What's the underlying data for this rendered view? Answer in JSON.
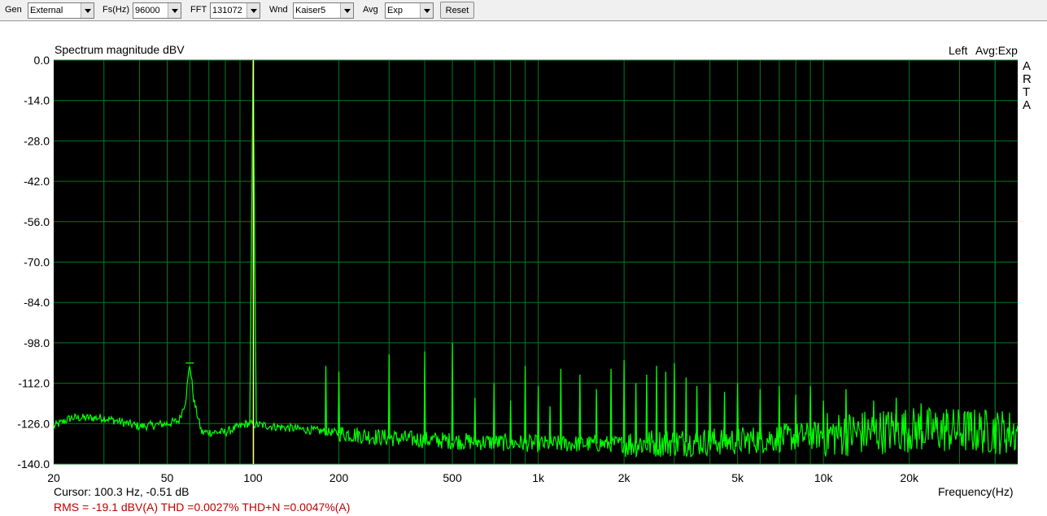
{
  "toolbar": {
    "gen_label": "Gen",
    "gen_value": "External",
    "fs_label": "Fs(Hz)",
    "fs_value": "96000",
    "fft_label": "FFT",
    "fft_value": "131072",
    "wnd_label": "Wnd",
    "wnd_value": "Kaiser5",
    "avg_label": "Avg",
    "avg_value": "Exp",
    "reset_label": "Reset"
  },
  "header": {
    "channel": "Left",
    "avg": "Avg:Exp",
    "brand": [
      "A",
      "R",
      "T",
      "A"
    ]
  },
  "status": {
    "cursor": "Cursor:   100.3 Hz, -0.51 dB",
    "measurements": "RMS =  -19.1 dBV(A)   THD =0.0027%   THD+N =0.0047%(A)"
  },
  "colors": {
    "plot_bg": "#000000",
    "grid": "#007a1f",
    "trace": "#00ff00",
    "cursor": "#ffff80",
    "measure_text": "#c00000"
  },
  "chart_data": {
    "type": "line",
    "title": "Spectrum magnitude dBV",
    "xlabel": "Frequency(Hz)",
    "ylabel": "",
    "xscale": "log",
    "xlim": [
      20,
      48000
    ],
    "ylim": [
      -140,
      0
    ],
    "grid": true,
    "x_ticks": [
      20,
      50,
      100,
      200,
      500,
      1000,
      2000,
      5000,
      10000,
      20000
    ],
    "x_tick_labels": [
      "20",
      "50",
      "100",
      "200",
      "500",
      "1k",
      "2k",
      "5k",
      "10k",
      "20k"
    ],
    "y_ticks": [
      0,
      -14,
      -28,
      -42,
      -56,
      -70,
      -84,
      -98,
      -112,
      -126,
      -140
    ],
    "y_tick_labels": [
      "0.0",
      "-14.0",
      "-28.0",
      "-42.0",
      "-56.0",
      "-70.0",
      "-84.0",
      "-98.0",
      "-112.0",
      "-126.0",
      "-140.0"
    ],
    "cursor_hz": 100.3,
    "noise_floor": [
      [
        20,
        -127
      ],
      [
        23,
        -124
      ],
      [
        30,
        -124
      ],
      [
        40,
        -127
      ],
      [
        50,
        -126
      ],
      [
        55,
        -125
      ],
      [
        58,
        -118
      ],
      [
        60,
        -105
      ],
      [
        62,
        -118
      ],
      [
        66,
        -129
      ],
      [
        80,
        -129
      ],
      [
        95,
        -126
      ],
      [
        150,
        -128
      ],
      [
        300,
        -131
      ],
      [
        500,
        -132
      ],
      [
        1000,
        -133
      ],
      [
        2000,
        -133
      ],
      [
        5000,
        -132
      ],
      [
        10000,
        -130
      ],
      [
        20000,
        -128
      ],
      [
        48000,
        -129
      ]
    ],
    "peaks": [
      {
        "hz": 60,
        "db": -105
      },
      {
        "hz": 100,
        "db": 0
      },
      {
        "hz": 180,
        "db": -106
      },
      {
        "hz": 200,
        "db": -108
      },
      {
        "hz": 300,
        "db": -102
      },
      {
        "hz": 400,
        "db": -101
      },
      {
        "hz": 500,
        "db": -98
      },
      {
        "hz": 600,
        "db": -117
      },
      {
        "hz": 700,
        "db": -112
      },
      {
        "hz": 800,
        "db": -118
      },
      {
        "hz": 900,
        "db": -106
      },
      {
        "hz": 1000,
        "db": -113
      },
      {
        "hz": 1100,
        "db": -120
      },
      {
        "hz": 1200,
        "db": -107
      },
      {
        "hz": 1400,
        "db": -109
      },
      {
        "hz": 1600,
        "db": -114
      },
      {
        "hz": 1800,
        "db": -107
      },
      {
        "hz": 2000,
        "db": -104
      },
      {
        "hz": 2200,
        "db": -112
      },
      {
        "hz": 2400,
        "db": -109
      },
      {
        "hz": 2600,
        "db": -106
      },
      {
        "hz": 2800,
        "db": -108
      },
      {
        "hz": 3000,
        "db": -105
      },
      {
        "hz": 3300,
        "db": -110
      },
      {
        "hz": 3600,
        "db": -113
      },
      {
        "hz": 4000,
        "db": -112
      },
      {
        "hz": 4500,
        "db": -115
      },
      {
        "hz": 5000,
        "db": -112
      },
      {
        "hz": 6000,
        "db": -114
      },
      {
        "hz": 7000,
        "db": -113
      },
      {
        "hz": 8000,
        "db": -116
      },
      {
        "hz": 9000,
        "db": -113
      },
      {
        "hz": 10000,
        "db": -118
      },
      {
        "hz": 12000,
        "db": -114
      },
      {
        "hz": 15000,
        "db": -118
      },
      {
        "hz": 18000,
        "db": -117
      },
      {
        "hz": 22000,
        "db": -119
      },
      {
        "hz": 27000,
        "db": -121
      },
      {
        "hz": 33000,
        "db": -122
      },
      {
        "hz": 40000,
        "db": -124
      }
    ]
  }
}
